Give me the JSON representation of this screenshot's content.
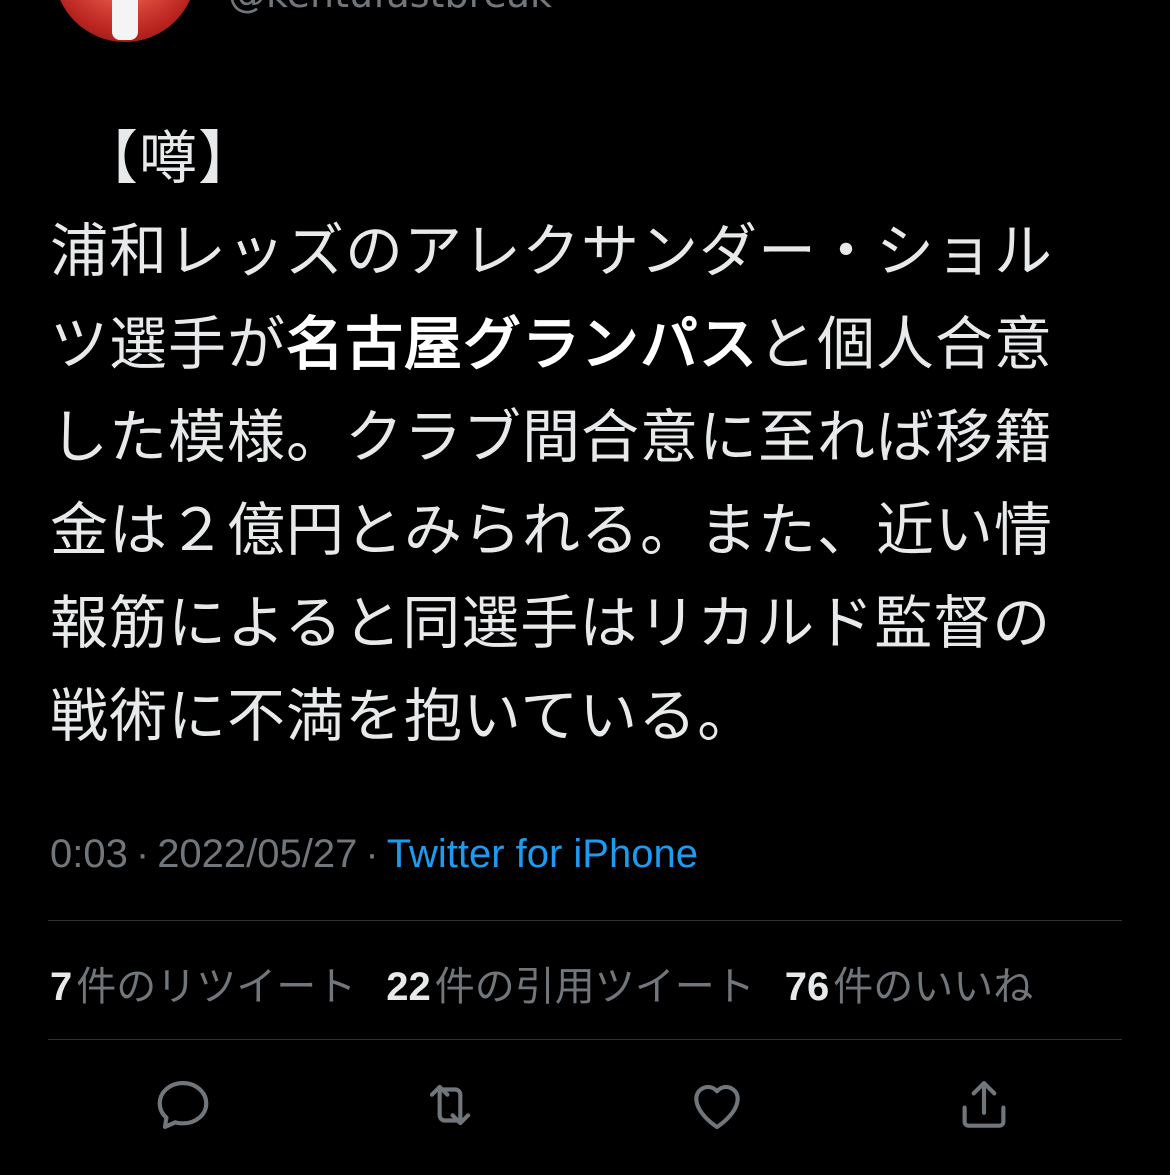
{
  "author": {
    "handle": "@kentufastbreak"
  },
  "tweet": {
    "lines": [
      {
        "prefix": "【噂】",
        "bold": "",
        "suffix": ""
      },
      {
        "prefix": "浦和レッズのアレクサンダー・ショル",
        "bold": "",
        "suffix": ""
      },
      {
        "prefix": "ツ選手が",
        "bold": "名古屋グランパス",
        "suffix": "と個人合意"
      },
      {
        "prefix": "した模様。クラブ間合意に至れば移籍",
        "bold": "",
        "suffix": ""
      },
      {
        "prefix": "金は２億円とみられる。また、近い情",
        "bold": "",
        "suffix": ""
      },
      {
        "prefix": "報筋によると同選手はリカルド監督の",
        "bold": "",
        "suffix": ""
      },
      {
        "prefix": "戦術に不満を抱いている。",
        "bold": "",
        "suffix": ""
      }
    ]
  },
  "meta": {
    "time": "0:03",
    "separator": "·",
    "date": "2022/05/27",
    "source": "Twitter for iPhone"
  },
  "stats": {
    "retweets": {
      "count": "7",
      "label": "件のリツイート"
    },
    "quotes": {
      "count": "22",
      "label": "件の引用ツイート"
    },
    "likes": {
      "count": "76",
      "label": "件のいいね"
    }
  },
  "actions": {
    "reply": "reply-icon",
    "retweet": "retweet-icon",
    "like": "heart-icon",
    "share": "share-icon"
  },
  "colors": {
    "background": "#000000",
    "text": "#e7e9ea",
    "secondary": "#71767b",
    "link": "#1d9bf0",
    "divider": "#2f3336"
  }
}
